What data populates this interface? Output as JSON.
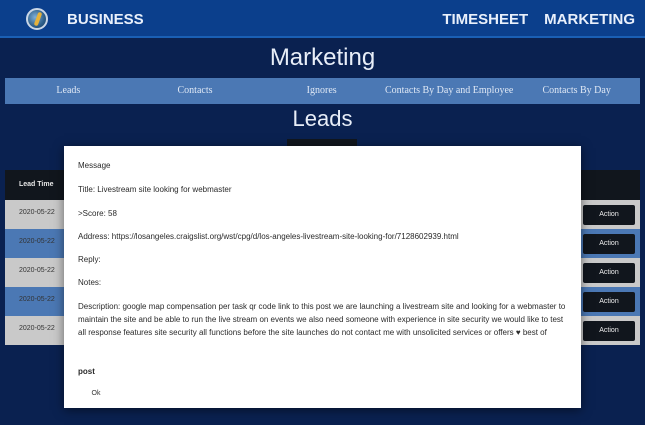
{
  "header": {
    "brand": "BUSINESS",
    "links": [
      "TIMESHEET",
      "MARKETING"
    ]
  },
  "page_title": "Marketing",
  "tabs": [
    "Leads",
    "Contacts",
    "Ignores",
    "Contacts By Day and Employee",
    "Contacts By Day"
  ],
  "section_title": "Leads",
  "table": {
    "header": "Lead Time",
    "rows": [
      {
        "date": "2020-05-22",
        "action": "Action",
        "bg": "#c9c9c9"
      },
      {
        "date": "2020-05-22",
        "action": "Action",
        "bg": "#4b78b4"
      },
      {
        "date": "2020-05-22",
        "action": "Action",
        "bg": "#c9c9c9"
      },
      {
        "date": "2020-05-22",
        "action": "Action",
        "bg": "#4b78b4"
      },
      {
        "date": "2020-05-22",
        "action": "Action",
        "bg": "#c9c9c9"
      }
    ]
  },
  "modal": {
    "heading": "Message",
    "title": "Title: Livestream site looking for webmaster",
    "score": ">Score: 58",
    "address": "Address: https://losangeles.craigslist.org/wst/cpg/d/los-angeles-livestream-site-looking-for/7128602939.html",
    "reply": "Reply:",
    "notes": "Notes:",
    "description": "Description: google map compensation per task qr code link to this post we are launching a livestream site and looking for a webmaster to maintain the site and be able to run the live stream on events we also need someone with experience in site security we would like to test all response features site security all functions before the site launches do not contact me with unsolicited services or offers ♥ best of",
    "post": "post",
    "ok": "Ok"
  }
}
